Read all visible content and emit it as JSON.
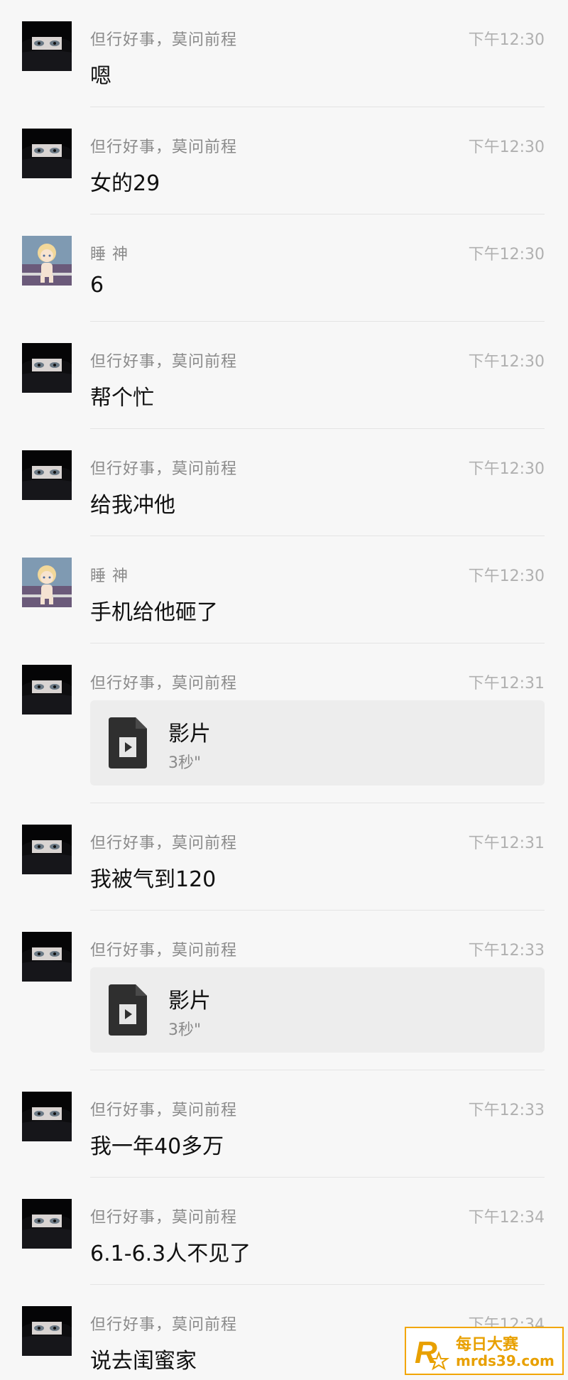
{
  "messages": [
    {
      "sender": "但行好事，莫问前程",
      "time": "下午12:30",
      "text": "嗯",
      "avatar": "dark-hair-avatar"
    },
    {
      "sender": "但行好事，莫问前程",
      "time": "下午12:30",
      "text": "女的29",
      "avatar": "dark-hair-avatar"
    },
    {
      "sender": "睡 神",
      "time": "下午12:30",
      "text": "6",
      "avatar": "blonde-child-avatar"
    },
    {
      "sender": "但行好事，莫问前程",
      "time": "下午12:30",
      "text": "帮个忙",
      "avatar": "dark-hair-avatar"
    },
    {
      "sender": "但行好事，莫问前程",
      "time": "下午12:30",
      "text": "给我冲他",
      "avatar": "dark-hair-avatar"
    },
    {
      "sender": "睡 神",
      "time": "下午12:30",
      "text": "手机给他砸了",
      "avatar": "blonde-child-avatar"
    },
    {
      "sender": "但行好事，莫问前程",
      "time": "下午12:31",
      "file": {
        "name": "影片",
        "meta": "3秒\""
      },
      "avatar": "dark-hair-avatar"
    },
    {
      "sender": "但行好事，莫问前程",
      "time": "下午12:31",
      "text": "我被气到120",
      "avatar": "dark-hair-avatar"
    },
    {
      "sender": "但行好事，莫问前程",
      "time": "下午12:33",
      "file": {
        "name": "影片",
        "meta": "3秒\""
      },
      "avatar": "dark-hair-avatar"
    },
    {
      "sender": "但行好事，莫问前程",
      "time": "下午12:33",
      "text": "我一年40多万",
      "avatar": "dark-hair-avatar"
    },
    {
      "sender": "但行好事，莫问前程",
      "time": "下午12:34",
      "text": "6.1-6.3人不见了",
      "avatar": "dark-hair-avatar"
    },
    {
      "sender": "但行好事，莫问前程",
      "time": "下午12:34",
      "text": "说去闺蜜家",
      "avatar": "dark-hair-avatar"
    }
  ],
  "watermark": {
    "title": "每日大赛",
    "url": "mrds39.com",
    "logo_letter": "R"
  },
  "colors": {
    "background": "#f7f7f7",
    "name": "#8a8a8a",
    "time": "#b0b0b0",
    "text": "#111111",
    "file_card": "#ededed",
    "watermark": "#e8a000"
  }
}
